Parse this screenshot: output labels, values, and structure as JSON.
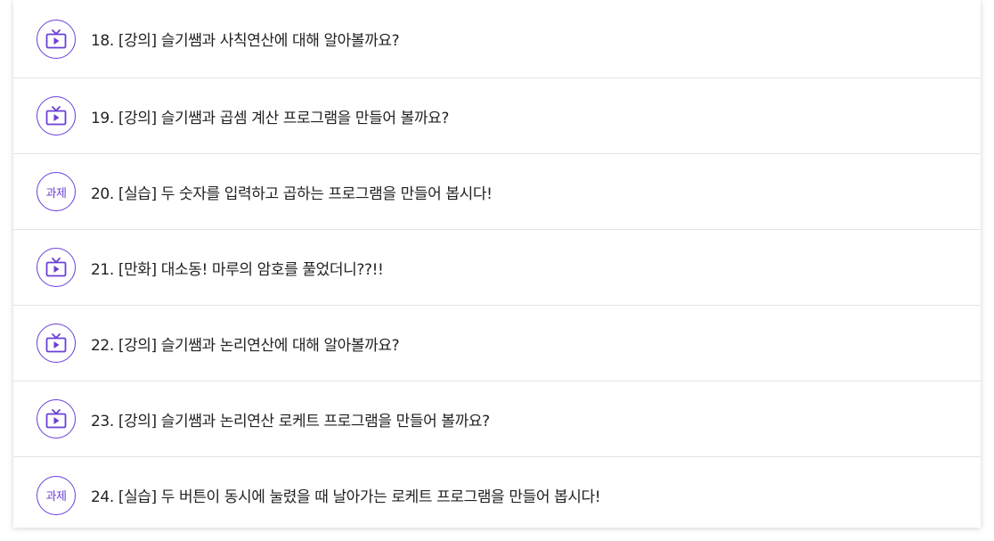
{
  "colors": {
    "accent": "#6b3fd4",
    "text": "#222222",
    "divider": "#e3e3e3"
  },
  "lessons": [
    {
      "kind": "video",
      "icon": "tv-play-icon",
      "title": "18. [강의] 슬기쌤과 사칙연산에 대해 알아볼까요?"
    },
    {
      "kind": "video",
      "icon": "tv-play-icon",
      "title": "19. [강의] 슬기쌤과 곱셈 계산 프로그램을 만들어 볼까요?"
    },
    {
      "kind": "assignment",
      "badge_label": "과제",
      "title": "20. [실습] 두 숫자를 입력하고 곱하는 프로그램을 만들어 봅시다!"
    },
    {
      "kind": "video",
      "icon": "tv-play-icon",
      "title": "21. [만화] 대소동! 마루의 암호를 풀었더니??!!"
    },
    {
      "kind": "video",
      "icon": "tv-play-icon",
      "title": "22. [강의] 슬기쌤과 논리연산에 대해 알아볼까요?"
    },
    {
      "kind": "video",
      "icon": "tv-play-icon",
      "title": "23. [강의] 슬기쌤과 논리연산 로케트 프로그램을 만들어 볼까요?"
    },
    {
      "kind": "assignment",
      "badge_label": "과제",
      "title": "24. [실습] 두 버튼이 동시에 눌렸을 때 날아가는 로케트 프로그램을 만들어 봅시다!"
    }
  ]
}
